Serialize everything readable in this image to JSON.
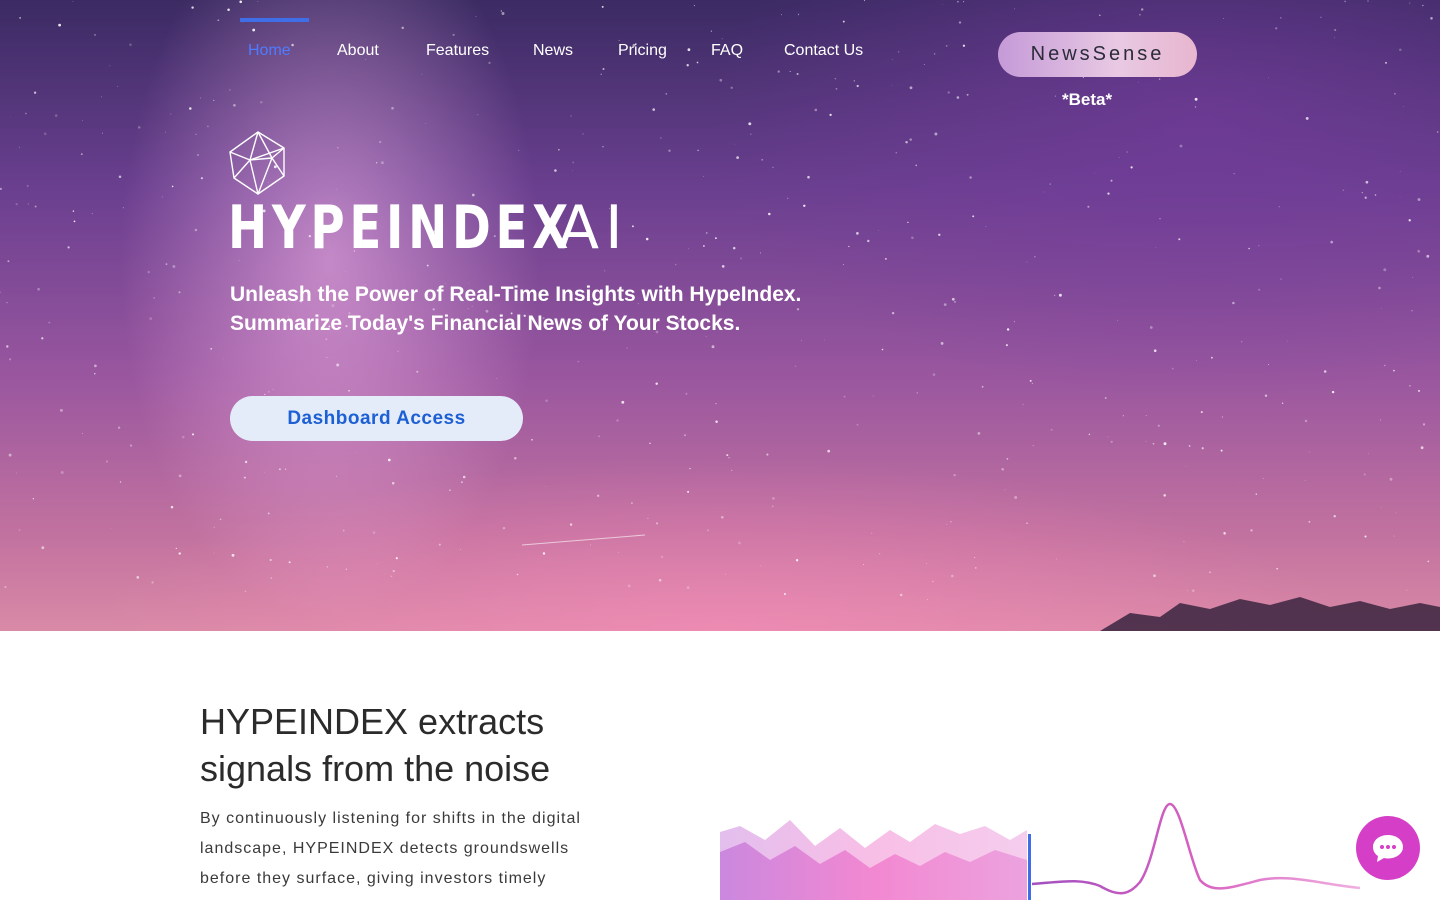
{
  "nav": {
    "items": [
      {
        "label": "Home",
        "active": true
      },
      {
        "label": "About"
      },
      {
        "label": "Features"
      },
      {
        "label": "News"
      },
      {
        "label": "Pricing"
      },
      {
        "label": "FAQ"
      },
      {
        "label": "Contact Us"
      }
    ]
  },
  "newssense": {
    "label": "NewsSense",
    "beta": "*Beta*"
  },
  "hero": {
    "brand_main": "HYPEINDEX",
    "brand_suffix": "AI",
    "tagline_line1": "Unleash the Power of Real-Time Insights with HypeIndex.",
    "tagline_line2": "Summarize Today's Financial News of Your Stocks.",
    "cta_label": "Dashboard Access"
  },
  "section": {
    "headline_line1": "HYPEINDEX extracts",
    "headline_line2": "signals from the noise",
    "body_line1": "By continuously listening for shifts in the digital",
    "body_line2": "landscape, HYPEINDEX detects groundswells",
    "body_line3": "before they surface, giving investors timely"
  },
  "colors": {
    "accent": "#3f6ee8",
    "cta_text": "#1d5fd4",
    "chat": "#d53ec6"
  },
  "icons": {
    "logo": "gem-wireframe-icon",
    "chat": "chat-bubble-icon"
  }
}
